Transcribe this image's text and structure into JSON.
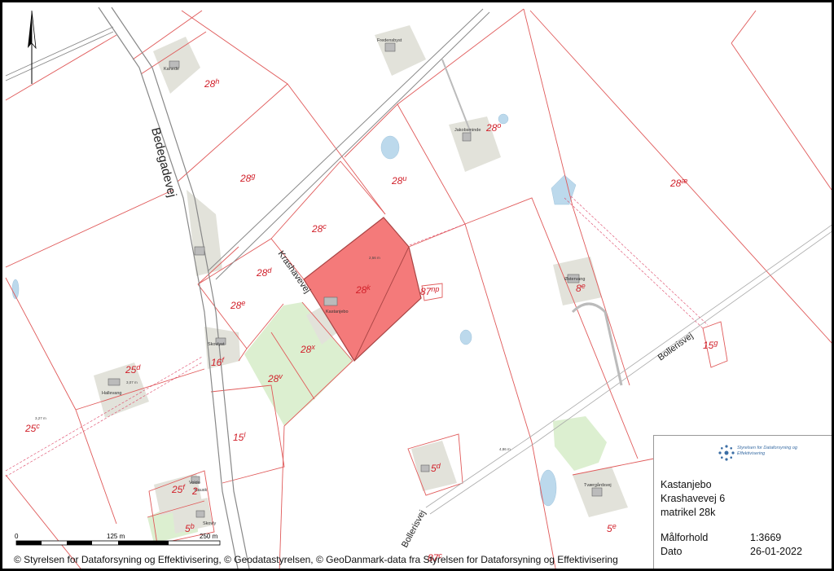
{
  "map": {
    "roads": {
      "bedegadevej": "Bedegadevej",
      "krashavevej": "Krashavevej",
      "bollerisvej_east": "Bollerisvej",
      "bollerisvej_south": "Bollerisvej"
    },
    "parcels": [
      {
        "num": "28",
        "sup": "h"
      },
      {
        "num": "28",
        "sup": "g"
      },
      {
        "num": "28",
        "sup": "o"
      },
      {
        "num": "28",
        "sup": "u"
      },
      {
        "num": "28",
        "sup": "æ"
      },
      {
        "num": "28",
        "sup": "c"
      },
      {
        "num": "28",
        "sup": "d"
      },
      {
        "num": "28",
        "sup": "k"
      },
      {
        "num": "87",
        "sup": "np"
      },
      {
        "num": "28",
        "sup": "e"
      },
      {
        "num": "28",
        "sup": "x"
      },
      {
        "num": "16",
        "sup": "f"
      },
      {
        "num": "25",
        "sup": "d"
      },
      {
        "num": "28",
        "sup": "v"
      },
      {
        "num": "15",
        "sup": "g"
      },
      {
        "num": "25",
        "sup": "c"
      },
      {
        "num": "15",
        "sup": "l"
      },
      {
        "num": "5",
        "sup": "d"
      },
      {
        "num": "25",
        "sup": "f"
      },
      {
        "num": "5",
        "sup": "b"
      },
      {
        "num": "5",
        "sup": "e"
      },
      {
        "num": "87",
        "sup": "c"
      },
      {
        "num": "2",
        "sup": ""
      },
      {
        "num": "8",
        "sup": "e"
      }
    ],
    "houses": {
      "kaneda": "Kanede",
      "fredensly": "Fredensbyst",
      "jakobsminde": "Jakobsminde",
      "kastanjebo": "Kastanjebo",
      "skovlyst": "Skovlyst",
      "hallevang": "Hallevang",
      "ostervang": "Østervang",
      "voldo": "Voldo",
      "kausk": "Kausk",
      "skovly": "Skovly",
      "toeregaard": "Tværgårdsvej"
    },
    "dims": [
      "2,56 m",
      "4,86 m",
      "3,07 m",
      "3,27 m"
    ]
  },
  "scalebar": {
    "labels": [
      "0",
      "125 m",
      "250 m"
    ]
  },
  "info": {
    "logo_text": "Styrelsen for Dataforsyning og Effektivisering",
    "lines": [
      "Kastanjebo",
      "Krashavevej 6",
      "matrikel 28k"
    ],
    "meta": [
      {
        "label": "Målforhold",
        "value": "1:3669"
      },
      {
        "label": "Dato",
        "value": "26-01-2022"
      }
    ]
  },
  "copyright": "© Styrelsen for Dataforsyning og Effektivisering, © Geodatastyrelsen, © GeoDanmark-data fra Styrelsen for Dataforsyning og Effektivisering",
  "colors": {
    "parcel_line": "#e05a5a",
    "selected_fill": "#f47a7a",
    "green": "#dcefd0",
    "grey_area": "#e2e2da"
  }
}
